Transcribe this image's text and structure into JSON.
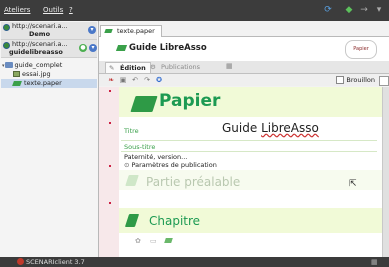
{
  "menubar": {
    "items": [
      "Ateliers",
      "Outils",
      "?"
    ]
  },
  "left_panel": {
    "repositories": [
      {
        "url": "http://scenari.a...",
        "name": "Demo"
      },
      {
        "url": "http://scenari.a...",
        "name": "guidelibreasso"
      }
    ],
    "tree": [
      {
        "label": "guide_complet",
        "icon": "folder-icon"
      },
      {
        "label": "essai.jpg",
        "icon": "image-file-icon"
      },
      {
        "label": "texte.paper",
        "icon": "paper-doc-icon"
      }
    ]
  },
  "editor": {
    "tab_label": "texte.paper",
    "header_title": "Guide LibreAsso",
    "model_badge": "Papier",
    "modes": [
      "Édition",
      "Publications"
    ],
    "draft_label": "Brouillon",
    "doc_heading": "Papier",
    "fields": {
      "titre_label": "Titre",
      "titre_value_pre": "Guide ",
      "titre_value_err": "LibreAsso",
      "sous_titre_label": "Sous-titre",
      "paternite": "Paternité, version...",
      "params": "Paramètres de publication"
    },
    "sections": {
      "partie_prealable": "Partie préalable",
      "chapitre": "Chapitre"
    }
  },
  "status_bar": {
    "text": "SCENARIclient 3.7"
  },
  "colors": {
    "brand_green": "#1c9a52",
    "accent_red": "#cc2244",
    "dark_bar": "#3c3c3c"
  }
}
